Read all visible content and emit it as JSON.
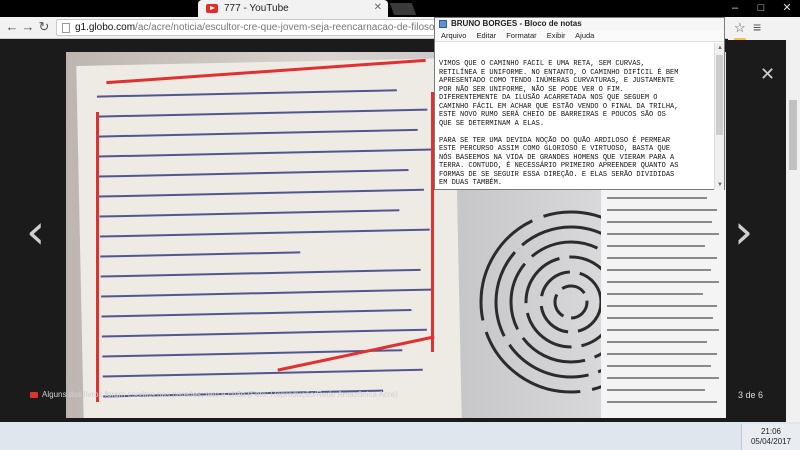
{
  "browser": {
    "tab_title": "777 - YouTube",
    "tab_icon": "youtube-icon",
    "url_host": "g1.globo.com",
    "url_path": "/ac/acre/noticia/escultor-cre-que-jovem-seja-reencarnacao-de-filosofo-e-tenha-complet",
    "back_icon": "back-arrow-icon",
    "forward_icon": "forward-arrow-icon",
    "reload_icon": "reload-icon",
    "bookmark_icon": "star-icon",
    "menu_icon": "menu-icon"
  },
  "notepad": {
    "title": "BRUNO BORGES - Bloco de notas",
    "menu": [
      "Arquivo",
      "Editar",
      "Formatar",
      "Exibir",
      "Ajuda"
    ],
    "text": "VIMOS QUE O CAMINHO FÁCIL É UMA RETA, SEM CURVAS,\nRETILÍNEA E UNIFORME. NO ENTANTO, O CAMINHO DIFÍCIL É BEM\nAPRESENTADO COMO TENDO INÚMERAS CURVATURAS, E JUSTAMENTE\nPOR NÃO SER UNIFORME, NÃO SE PODE VER O FIM.\nDIFERENTEMENTE DA ILUSÃO ACARRETADA NOS QUE SEGUEM O\nCAMINHO FÁCIL EM ACHAR QUE ESTÃO VENDO O FINAL DA TRILHA,\nESTE NOVO RUMO SERÁ CHEIO DE BARREIRAS E POUCOS SÃO OS\nQUE SE DETERMINAM A ELAS.\n\nPARA SE TER UMA DEVIDA NOÇÃO DO QUÃO ARDILOSO É PERMEAR\nESTE PERCURSO ASSIM COMO GLORIOSO E VIRTUOSO, BASTA QUE\nNÓS BASEEMOS NA VIDA DE GRANDES HOMENS QUE VIERAM PARA A\nTERRA. CONTUDO, É NECESSÁRIO PRIMEIRO APREENDER QUANTO AS\nFORMAS DE SE SEGUIR ESSA DIREÇÃO. E ELAS SERÃO DIVIDIDAS\nEM DUAS TAMBÉM."
  },
  "gallery": {
    "caption": "Alguns dos livros foram escritos nas paredes, teto e chão (Foto: Reprodução/Rede Amazônica Acre)",
    "counter": "3 de 6",
    "prev_icon": "chevron-left-icon",
    "next_icon": "chevron-right-icon",
    "close_icon": "close-icon"
  },
  "taskbar": {
    "time": "21:06",
    "date": "05/04/2017"
  },
  "colors": {
    "annotation_red": "#e03030",
    "ink_blue": "#2a2f7a",
    "youtube_red": "#e52d27"
  }
}
